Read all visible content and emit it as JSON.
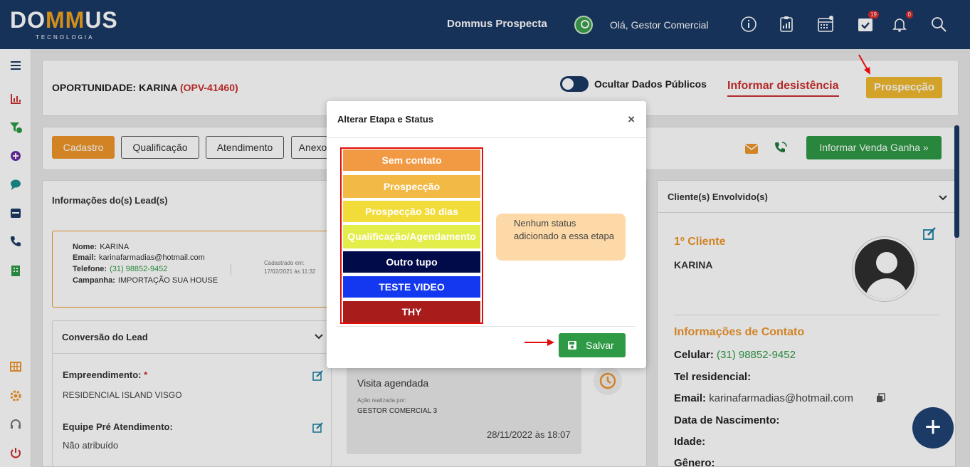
{
  "header": {
    "logo_main_left": "DO",
    "logo_mm": "MM",
    "logo_main_right": "US",
    "logo_sub": "TECNOLOGIA",
    "app_name": "Dommus Prospecta",
    "greeting": "Olá, Gestor Comercial",
    "tasks_badge": "19",
    "notifications_badge": "0"
  },
  "opportunity": {
    "title": "OPORTUNIDADE: KARINA",
    "code": "(OPV-41460)",
    "toggle_label": "Ocultar Dados Públicos",
    "give_up_label": "Informar desistência",
    "stage_label": "Prospecção"
  },
  "tabs": [
    "Cadastro",
    "Qualificação",
    "Atendimento",
    "Anexo"
  ],
  "win_button": "Informar Venda Ganha »",
  "leads": {
    "title": "Informações do(s) Lead(s)",
    "name_label": "Nome:",
    "name": "KARINA",
    "email_label": "Email:",
    "email": "karinafarmadias@hotmail.com",
    "phone_label": "Telefone:",
    "phone": "(31) 98852-9452",
    "campaign_label": "Campanha:",
    "campaign": "IMPORTAÇÃO SUA HOUSE",
    "registered_label": "Cadastrado em:",
    "registered_at": "17/02/2021 às 11:32"
  },
  "conversion": {
    "title": "Conversão do Lead",
    "development_label": "Empreendimento:",
    "required_mark": "*",
    "development": "RESIDENCIAL ISLAND VISGO",
    "team_label": "Equipe Pré Atendimento:",
    "team": "Não atribuído"
  },
  "history": {
    "title": "Visita agendada",
    "action_by_label": "Ação realizada por:",
    "action_by": "GESTOR COMERCIAL 3",
    "datetime": "28/11/2022 às 18:07"
  },
  "clients": {
    "title": "Cliente(s) Envolvido(s)",
    "first_client_label": "1º Cliente",
    "client_name": "KARINA",
    "contact_title": "Informações de Contato",
    "mobile_label": "Celular:",
    "mobile": "(31) 98852-9452",
    "home_phone_label": "Tel residencial:",
    "email_label": "Email:",
    "email": "karinafarmadias@hotmail.com",
    "birth_label": "Data de Nascimento:",
    "age_label": "Idade:",
    "gender_label": "Gênero:"
  },
  "modal": {
    "title": "Alterar Etapa e Status",
    "close": "×",
    "stages": [
      {
        "label": "Sem contato",
        "color": "#f29a43"
      },
      {
        "label": "Prospecção",
        "color": "#f2b945"
      },
      {
        "label": "Prospecção 30 dias",
        "color": "#f2dc3a"
      },
      {
        "label": "Qualificação/Agendamento",
        "color": "#e4ee4a"
      },
      {
        "label": "Outro tupo",
        "color": "#020b4a"
      },
      {
        "label": "TESTE VIDEO",
        "color": "#1437f0"
      },
      {
        "label": "THY",
        "color": "#a81c1c"
      }
    ],
    "empty_status": "Nenhum status adicionado a essa etapa",
    "save_label": "Salvar"
  },
  "colors": {
    "header_bg": "#1b3a66",
    "accent_orange": "#f0962a",
    "success_green": "#2e9a45",
    "danger_red": "#cc2f2f"
  }
}
